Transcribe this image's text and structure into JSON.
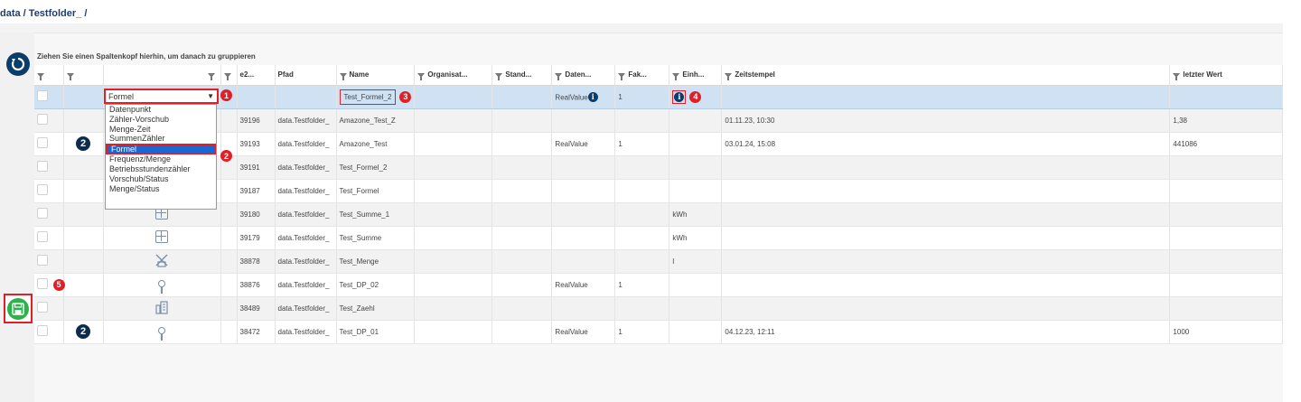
{
  "breadcrumb": "data / Testfolder_  /",
  "group_hint": "Ziehen Sie einen Spaltenkopf hierhin, um danach zu gruppieren",
  "columns": [
    "",
    "",
    "",
    "",
    "e2...",
    "Pfad",
    "Name",
    "Organisat...",
    "Stand...",
    "Daten...",
    "Fak...",
    "Einh...",
    "Zeitstempel",
    "letzter Wert"
  ],
  "dropdown": {
    "value": "Formel",
    "options": [
      "Datenpunkt",
      "Zähler-Vorschub",
      "Menge-Zeit",
      "SummenZähler",
      "Formel",
      "Frequenz/Menge",
      "Betriebsstundenzähler",
      "Vorschub/Status",
      "Menge/Status"
    ],
    "selected_index": 4
  },
  "badges": {
    "b1": "1",
    "b2": "2",
    "b3": "3",
    "b4": "4",
    "b5": "5",
    "left_b2": "2"
  },
  "rows": [
    {
      "id": "",
      "path": "",
      "name": "Test_Formel_2",
      "dtype": "RealValue",
      "fak": "1",
      "unit": "",
      "ts": "",
      "last": ""
    },
    {
      "id": "39196",
      "path": "data.Testfolder_",
      "name": "Amazone_Test_Z",
      "dtype": "",
      "fak": "",
      "unit": "",
      "ts": "01.11.23, 10:30",
      "last": "1,38"
    },
    {
      "id": "39193",
      "path": "data.Testfolder_",
      "name": "Amazone_Test",
      "dtype": "RealValue",
      "fak": "1",
      "unit": "",
      "ts": "03.01.24, 15:08",
      "last": "441086"
    },
    {
      "id": "39191",
      "path": "data.Testfolder_",
      "name": "Test_Formel_2",
      "dtype": "",
      "fak": "",
      "unit": "",
      "ts": "",
      "last": ""
    },
    {
      "id": "39187",
      "path": "data.Testfolder_",
      "name": "Test_Formel",
      "dtype": "",
      "fak": "",
      "unit": "",
      "ts": "",
      "last": ""
    },
    {
      "id": "39180",
      "path": "data.Testfolder_",
      "name": "Test_Summe_1",
      "dtype": "",
      "fak": "",
      "unit": "kWh",
      "ts": "",
      "last": ""
    },
    {
      "id": "39179",
      "path": "data.Testfolder_",
      "name": "Test_Summe",
      "dtype": "",
      "fak": "",
      "unit": "kWh",
      "ts": "",
      "last": ""
    },
    {
      "id": "38878",
      "path": "data.Testfolder_",
      "name": "Test_Menge",
      "dtype": "",
      "fak": "",
      "unit": "l",
      "ts": "",
      "last": ""
    },
    {
      "id": "38876",
      "path": "data.Testfolder_",
      "name": "Test_DP_02",
      "dtype": "RealValue",
      "fak": "1",
      "unit": "",
      "ts": "",
      "last": ""
    },
    {
      "id": "38489",
      "path": "data.Testfolder_",
      "name": "Test_Zaehl",
      "dtype": "",
      "fak": "",
      "unit": "",
      "ts": "",
      "last": ""
    },
    {
      "id": "38472",
      "path": "data.Testfolder_",
      "name": "Test_DP_01",
      "dtype": "RealValue",
      "fak": "1",
      "unit": "",
      "ts": "04.12.23, 12:11",
      "last": "1000"
    }
  ],
  "icons": {
    "refresh": "refresh-icon",
    "save": "save-icon",
    "filter": "filter-icon",
    "info": "info-icon",
    "type_icons": [
      "calculator-icon",
      "calculator-icon",
      "flow-meter-icon",
      "pin-icon",
      "building-icon",
      "pin-icon"
    ]
  }
}
